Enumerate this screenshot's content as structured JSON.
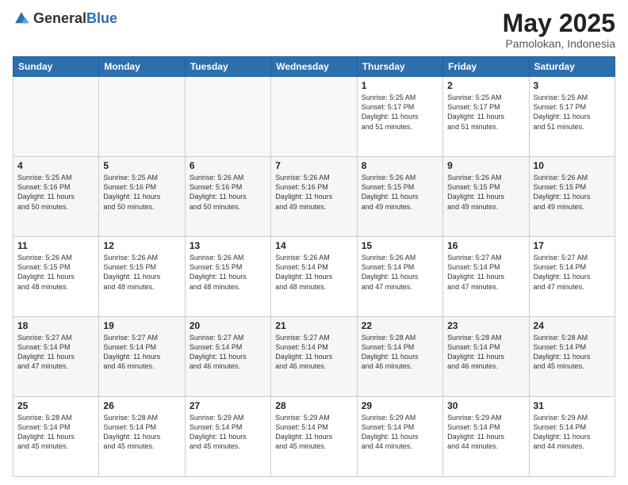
{
  "header": {
    "logo_general": "General",
    "logo_blue": "Blue",
    "month": "May 2025",
    "location": "Pamolokan, Indonesia"
  },
  "weekdays": [
    "Sunday",
    "Monday",
    "Tuesday",
    "Wednesday",
    "Thursday",
    "Friday",
    "Saturday"
  ],
  "weeks": [
    [
      {
        "day": "",
        "info": ""
      },
      {
        "day": "",
        "info": ""
      },
      {
        "day": "",
        "info": ""
      },
      {
        "day": "",
        "info": ""
      },
      {
        "day": "1",
        "info": "Sunrise: 5:25 AM\nSunset: 5:17 PM\nDaylight: 11 hours\nand 51 minutes."
      },
      {
        "day": "2",
        "info": "Sunrise: 5:25 AM\nSunset: 5:17 PM\nDaylight: 11 hours\nand 51 minutes."
      },
      {
        "day": "3",
        "info": "Sunrise: 5:25 AM\nSunset: 5:17 PM\nDaylight: 11 hours\nand 51 minutes."
      }
    ],
    [
      {
        "day": "4",
        "info": "Sunrise: 5:25 AM\nSunset: 5:16 PM\nDaylight: 11 hours\nand 50 minutes."
      },
      {
        "day": "5",
        "info": "Sunrise: 5:25 AM\nSunset: 5:16 PM\nDaylight: 11 hours\nand 50 minutes."
      },
      {
        "day": "6",
        "info": "Sunrise: 5:26 AM\nSunset: 5:16 PM\nDaylight: 11 hours\nand 50 minutes."
      },
      {
        "day": "7",
        "info": "Sunrise: 5:26 AM\nSunset: 5:16 PM\nDaylight: 11 hours\nand 49 minutes."
      },
      {
        "day": "8",
        "info": "Sunrise: 5:26 AM\nSunset: 5:15 PM\nDaylight: 11 hours\nand 49 minutes."
      },
      {
        "day": "9",
        "info": "Sunrise: 5:26 AM\nSunset: 5:15 PM\nDaylight: 11 hours\nand 49 minutes."
      },
      {
        "day": "10",
        "info": "Sunrise: 5:26 AM\nSunset: 5:15 PM\nDaylight: 11 hours\nand 49 minutes."
      }
    ],
    [
      {
        "day": "11",
        "info": "Sunrise: 5:26 AM\nSunset: 5:15 PM\nDaylight: 11 hours\nand 48 minutes."
      },
      {
        "day": "12",
        "info": "Sunrise: 5:26 AM\nSunset: 5:15 PM\nDaylight: 11 hours\nand 48 minutes."
      },
      {
        "day": "13",
        "info": "Sunrise: 5:26 AM\nSunset: 5:15 PM\nDaylight: 11 hours\nand 48 minutes."
      },
      {
        "day": "14",
        "info": "Sunrise: 5:26 AM\nSunset: 5:14 PM\nDaylight: 11 hours\nand 48 minutes."
      },
      {
        "day": "15",
        "info": "Sunrise: 5:26 AM\nSunset: 5:14 PM\nDaylight: 11 hours\nand 47 minutes."
      },
      {
        "day": "16",
        "info": "Sunrise: 5:27 AM\nSunset: 5:14 PM\nDaylight: 11 hours\nand 47 minutes."
      },
      {
        "day": "17",
        "info": "Sunrise: 5:27 AM\nSunset: 5:14 PM\nDaylight: 11 hours\nand 47 minutes."
      }
    ],
    [
      {
        "day": "18",
        "info": "Sunrise: 5:27 AM\nSunset: 5:14 PM\nDaylight: 11 hours\nand 47 minutes."
      },
      {
        "day": "19",
        "info": "Sunrise: 5:27 AM\nSunset: 5:14 PM\nDaylight: 11 hours\nand 46 minutes."
      },
      {
        "day": "20",
        "info": "Sunrise: 5:27 AM\nSunset: 5:14 PM\nDaylight: 11 hours\nand 46 minutes."
      },
      {
        "day": "21",
        "info": "Sunrise: 5:27 AM\nSunset: 5:14 PM\nDaylight: 11 hours\nand 46 minutes."
      },
      {
        "day": "22",
        "info": "Sunrise: 5:28 AM\nSunset: 5:14 PM\nDaylight: 11 hours\nand 46 minutes."
      },
      {
        "day": "23",
        "info": "Sunrise: 5:28 AM\nSunset: 5:14 PM\nDaylight: 11 hours\nand 46 minutes."
      },
      {
        "day": "24",
        "info": "Sunrise: 5:28 AM\nSunset: 5:14 PM\nDaylight: 11 hours\nand 45 minutes."
      }
    ],
    [
      {
        "day": "25",
        "info": "Sunrise: 5:28 AM\nSunset: 5:14 PM\nDaylight: 11 hours\nand 45 minutes."
      },
      {
        "day": "26",
        "info": "Sunrise: 5:28 AM\nSunset: 5:14 PM\nDaylight: 11 hours\nand 45 minutes."
      },
      {
        "day": "27",
        "info": "Sunrise: 5:29 AM\nSunset: 5:14 PM\nDaylight: 11 hours\nand 45 minutes."
      },
      {
        "day": "28",
        "info": "Sunrise: 5:29 AM\nSunset: 5:14 PM\nDaylight: 11 hours\nand 45 minutes."
      },
      {
        "day": "29",
        "info": "Sunrise: 5:29 AM\nSunset: 5:14 PM\nDaylight: 11 hours\nand 44 minutes."
      },
      {
        "day": "30",
        "info": "Sunrise: 5:29 AM\nSunset: 5:14 PM\nDaylight: 11 hours\nand 44 minutes."
      },
      {
        "day": "31",
        "info": "Sunrise: 5:29 AM\nSunset: 5:14 PM\nDaylight: 11 hours\nand 44 minutes."
      }
    ]
  ]
}
